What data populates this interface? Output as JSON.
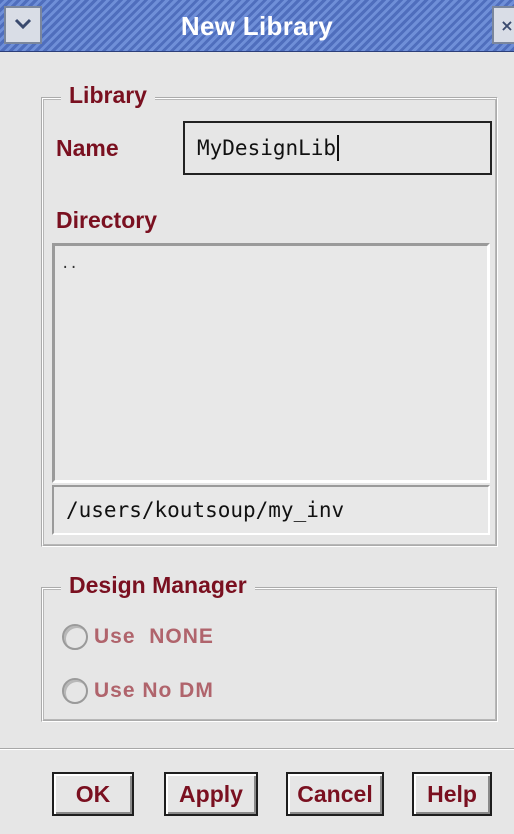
{
  "window": {
    "title": "New Library",
    "menu_icon": "chevron-down-icon",
    "close_icon": "close-icon",
    "close_glyph": "×"
  },
  "library_group": {
    "legend": "Library",
    "name_label": "Name",
    "name_value": "MyDesignLib",
    "directory_label": "Directory",
    "directory_items": [
      ".."
    ],
    "path_value": "/users/koutsoup/my_inv"
  },
  "design_manager_group": {
    "legend": "Design Manager",
    "options": [
      {
        "label": "Use  NONE",
        "selected": false,
        "enabled": false
      },
      {
        "label": "Use No DM",
        "selected": false,
        "enabled": false
      }
    ]
  },
  "buttons": {
    "ok": "OK",
    "apply": "Apply",
    "cancel": "Cancel",
    "help": "Help"
  },
  "colors": {
    "label": "#7a1020",
    "disabled_label": "#b0646c",
    "title_bar": "#4f6ebd"
  }
}
